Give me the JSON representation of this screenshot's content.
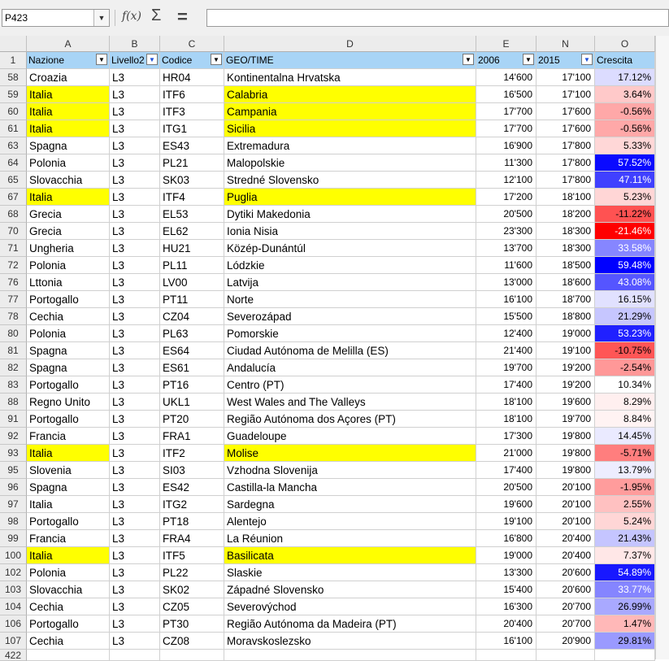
{
  "namebox": {
    "value": "P423"
  },
  "formula": {
    "fx_label": "f(x)",
    "sum_label": "Σ",
    "equals_label": "=",
    "value": ""
  },
  "columns": [
    "A",
    "B",
    "C",
    "D",
    "E",
    "N",
    "O"
  ],
  "headers": {
    "row_number": "1",
    "fields": [
      "Nazione",
      "Livello2",
      "Codice",
      "GEO/TIME",
      "2006",
      "2015",
      "Crescita"
    ],
    "filter_active": [
      false,
      true,
      false,
      false,
      false,
      true,
      false
    ]
  },
  "rows": [
    {
      "n": "58",
      "nazione": "Croazia",
      "livello": "L3",
      "codice": "HR04",
      "geo": "Kontinentalna Hrvatska",
      "y2006": "14'600",
      "y2015": "17'100",
      "crescita": "17.12%",
      "hl": false
    },
    {
      "n": "59",
      "nazione": "Italia",
      "livello": "L3",
      "codice": "ITF6",
      "geo": "Calabria",
      "y2006": "16'500",
      "y2015": "17'100",
      "crescita": "3.64%",
      "hl": true
    },
    {
      "n": "60",
      "nazione": "Italia",
      "livello": "L3",
      "codice": "ITF3",
      "geo": "Campania",
      "y2006": "17'700",
      "y2015": "17'600",
      "crescita": "-0.56%",
      "hl": true
    },
    {
      "n": "61",
      "nazione": "Italia",
      "livello": "L3",
      "codice": "ITG1",
      "geo": "Sicilia",
      "y2006": "17'700",
      "y2015": "17'600",
      "crescita": "-0.56%",
      "hl": true
    },
    {
      "n": "63",
      "nazione": "Spagna",
      "livello": "L3",
      "codice": "ES43",
      "geo": "Extremadura",
      "y2006": "16'900",
      "y2015": "17'800",
      "crescita": "5.33%",
      "hl": false
    },
    {
      "n": "64",
      "nazione": "Polonia",
      "livello": "L3",
      "codice": "PL21",
      "geo": "Malopolskie",
      "y2006": "11'300",
      "y2015": "17'800",
      "crescita": "57.52%",
      "hl": false
    },
    {
      "n": "65",
      "nazione": "Slovacchia",
      "livello": "L3",
      "codice": "SK03",
      "geo": "Stredné Slovensko",
      "y2006": "12'100",
      "y2015": "17'800",
      "crescita": "47.11%",
      "hl": false
    },
    {
      "n": "67",
      "nazione": "Italia",
      "livello": "L3",
      "codice": "ITF4",
      "geo": "Puglia",
      "y2006": "17'200",
      "y2015": "18'100",
      "crescita": "5.23%",
      "hl": true
    },
    {
      "n": "68",
      "nazione": "Grecia",
      "livello": "L3",
      "codice": "EL53",
      "geo": "Dytiki Makedonia",
      "y2006": "20'500",
      "y2015": "18'200",
      "crescita": "-11.22%",
      "hl": false
    },
    {
      "n": "70",
      "nazione": "Grecia",
      "livello": "L3",
      "codice": "EL62",
      "geo": "Ionia Nisia",
      "y2006": "23'300",
      "y2015": "18'300",
      "crescita": "-21.46%",
      "hl": false
    },
    {
      "n": "71",
      "nazione": "Ungheria",
      "livello": "L3",
      "codice": "HU21",
      "geo": "Közép-Dunántúl",
      "y2006": "13'700",
      "y2015": "18'300",
      "crescita": "33.58%",
      "hl": false
    },
    {
      "n": "72",
      "nazione": "Polonia",
      "livello": "L3",
      "codice": "PL11",
      "geo": "Lódzkie",
      "y2006": "11'600",
      "y2015": "18'500",
      "crescita": "59.48%",
      "hl": false
    },
    {
      "n": "76",
      "nazione": "Lttonia",
      "livello": "L3",
      "codice": "LV00",
      "geo": "Latvija",
      "y2006": "13'000",
      "y2015": "18'600",
      "crescita": "43.08%",
      "hl": false
    },
    {
      "n": "77",
      "nazione": "Portogallo",
      "livello": "L3",
      "codice": "PT11",
      "geo": "Norte",
      "y2006": "16'100",
      "y2015": "18'700",
      "crescita": "16.15%",
      "hl": false
    },
    {
      "n": "78",
      "nazione": "Cechia",
      "livello": "L3",
      "codice": "CZ04",
      "geo": "Severozápad",
      "y2006": "15'500",
      "y2015": "18'800",
      "crescita": "21.29%",
      "hl": false
    },
    {
      "n": "80",
      "nazione": "Polonia",
      "livello": "L3",
      "codice": "PL63",
      "geo": "Pomorskie",
      "y2006": "12'400",
      "y2015": "19'000",
      "crescita": "53.23%",
      "hl": false
    },
    {
      "n": "81",
      "nazione": "Spagna",
      "livello": "L3",
      "codice": "ES64",
      "geo": "Ciudad Autónoma de Melilla (ES)",
      "y2006": "21'400",
      "y2015": "19'100",
      "crescita": "-10.75%",
      "hl": false
    },
    {
      "n": "82",
      "nazione": "Spagna",
      "livello": "L3",
      "codice": "ES61",
      "geo": "Andalucía",
      "y2006": "19'700",
      "y2015": "19'200",
      "crescita": "-2.54%",
      "hl": false
    },
    {
      "n": "83",
      "nazione": "Portogallo",
      "livello": "L3",
      "codice": "PT16",
      "geo": "Centro (PT)",
      "y2006": "17'400",
      "y2015": "19'200",
      "crescita": "10.34%",
      "hl": false
    },
    {
      "n": "88",
      "nazione": "Regno Unito",
      "livello": "L3",
      "codice": "UKL1",
      "geo": "West Wales and The Valleys",
      "y2006": "18'100",
      "y2015": "19'600",
      "crescita": "8.29%",
      "hl": false
    },
    {
      "n": "91",
      "nazione": "Portogallo",
      "livello": "L3",
      "codice": "PT20",
      "geo": "Região Autónoma dos Açores (PT)",
      "y2006": "18'100",
      "y2015": "19'700",
      "crescita": "8.84%",
      "hl": false
    },
    {
      "n": "92",
      "nazione": "Francia",
      "livello": "L3",
      "codice": "FRA1",
      "geo": "Guadeloupe",
      "y2006": "17'300",
      "y2015": "19'800",
      "crescita": "14.45%",
      "hl": false
    },
    {
      "n": "93",
      "nazione": "Italia",
      "livello": "L3",
      "codice": "ITF2",
      "geo": "Molise",
      "y2006": "21'000",
      "y2015": "19'800",
      "crescita": "-5.71%",
      "hl": true
    },
    {
      "n": "95",
      "nazione": "Slovenia",
      "livello": "L3",
      "codice": "SI03",
      "geo": "Vzhodna Slovenija",
      "y2006": "17'400",
      "y2015": "19'800",
      "crescita": "13.79%",
      "hl": false
    },
    {
      "n": "96",
      "nazione": "Spagna",
      "livello": "L3",
      "codice": "ES42",
      "geo": "Castilla-la Mancha",
      "y2006": "20'500",
      "y2015": "20'100",
      "crescita": "-1.95%",
      "hl": false
    },
    {
      "n": "97",
      "nazione": "Italia",
      "livello": "L3",
      "codice": "ITG2",
      "geo": "Sardegna",
      "y2006": "19'600",
      "y2015": "20'100",
      "crescita": "2.55%",
      "hl": false
    },
    {
      "n": "98",
      "nazione": "Portogallo",
      "livello": "L3",
      "codice": "PT18",
      "geo": "Alentejo",
      "y2006": "19'100",
      "y2015": "20'100",
      "crescita": "5.24%",
      "hl": false
    },
    {
      "n": "99",
      "nazione": "Francia",
      "livello": "L3",
      "codice": "FRA4",
      "geo": "La Réunion",
      "y2006": "16'800",
      "y2015": "20'400",
      "crescita": "21.43%",
      "hl": false
    },
    {
      "n": "100",
      "nazione": "Italia",
      "livello": "L3",
      "codice": "ITF5",
      "geo": "Basilicata",
      "y2006": "19'000",
      "y2015": "20'400",
      "crescita": "7.37%",
      "hl": true
    },
    {
      "n": "102",
      "nazione": "Polonia",
      "livello": "L3",
      "codice": "PL22",
      "geo": "Slaskie",
      "y2006": "13'300",
      "y2015": "20'600",
      "crescita": "54.89%",
      "hl": false
    },
    {
      "n": "103",
      "nazione": "Slovacchia",
      "livello": "L3",
      "codice": "SK02",
      "geo": "Západné Slovensko",
      "y2006": "15'400",
      "y2015": "20'600",
      "crescita": "33.77%",
      "hl": false
    },
    {
      "n": "104",
      "nazione": "Cechia",
      "livello": "L3",
      "codice": "CZ05",
      "geo": "Severovýchod",
      "y2006": "16'300",
      "y2015": "20'700",
      "crescita": "26.99%",
      "hl": false
    },
    {
      "n": "106",
      "nazione": "Portogallo",
      "livello": "L3",
      "codice": "PT30",
      "geo": "Região Autónoma da Madeira (PT)",
      "y2006": "20'400",
      "y2015": "20'700",
      "crescita": "1.47%",
      "hl": false
    },
    {
      "n": "107",
      "nazione": "Cechia",
      "livello": "L3",
      "codice": "CZ08",
      "geo": "Moravskoslezsko",
      "y2006": "16'100",
      "y2015": "20'900",
      "crescita": "29.81%",
      "hl": false
    }
  ],
  "last_row": {
    "n": "422"
  },
  "colors": {
    "header_bg": "#a8d4f6",
    "highlight": "#ffff00",
    "scale_min": "#ff0000",
    "scale_mid": "#ffffff",
    "scale_max": "#0000ff"
  }
}
